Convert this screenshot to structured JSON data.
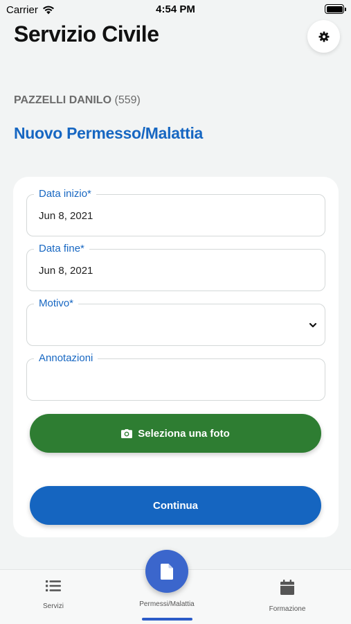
{
  "status_bar": {
    "carrier": "Carrier",
    "time": "4:54 PM"
  },
  "header": {
    "title": "Servizio Civile"
  },
  "user": {
    "name": "PAZZELLI DANILO",
    "id": "(559)"
  },
  "page": {
    "heading": "Nuovo Permesso/Malattia"
  },
  "form": {
    "start_date": {
      "label": "Data inizio*",
      "value": "Jun 8, 2021"
    },
    "end_date": {
      "label": "Data fine*",
      "value": "Jun 8, 2021"
    },
    "reason": {
      "label": "Motivo*",
      "value": ""
    },
    "notes": {
      "label": "Annotazioni",
      "value": ""
    },
    "photo_button": "Seleziona una foto",
    "continue_button": "Continua"
  },
  "tabs": [
    {
      "label": "Servizi",
      "icon": "list-icon"
    },
    {
      "label": "Permessi/Malattia",
      "icon": "document-icon",
      "active": true
    },
    {
      "label": "Formazione",
      "icon": "calendar-icon"
    }
  ],
  "colors": {
    "accent": "#1767c2",
    "photo_button": "#2e7d32",
    "continue_button": "#1565c0",
    "fab": "#3b66cc"
  }
}
